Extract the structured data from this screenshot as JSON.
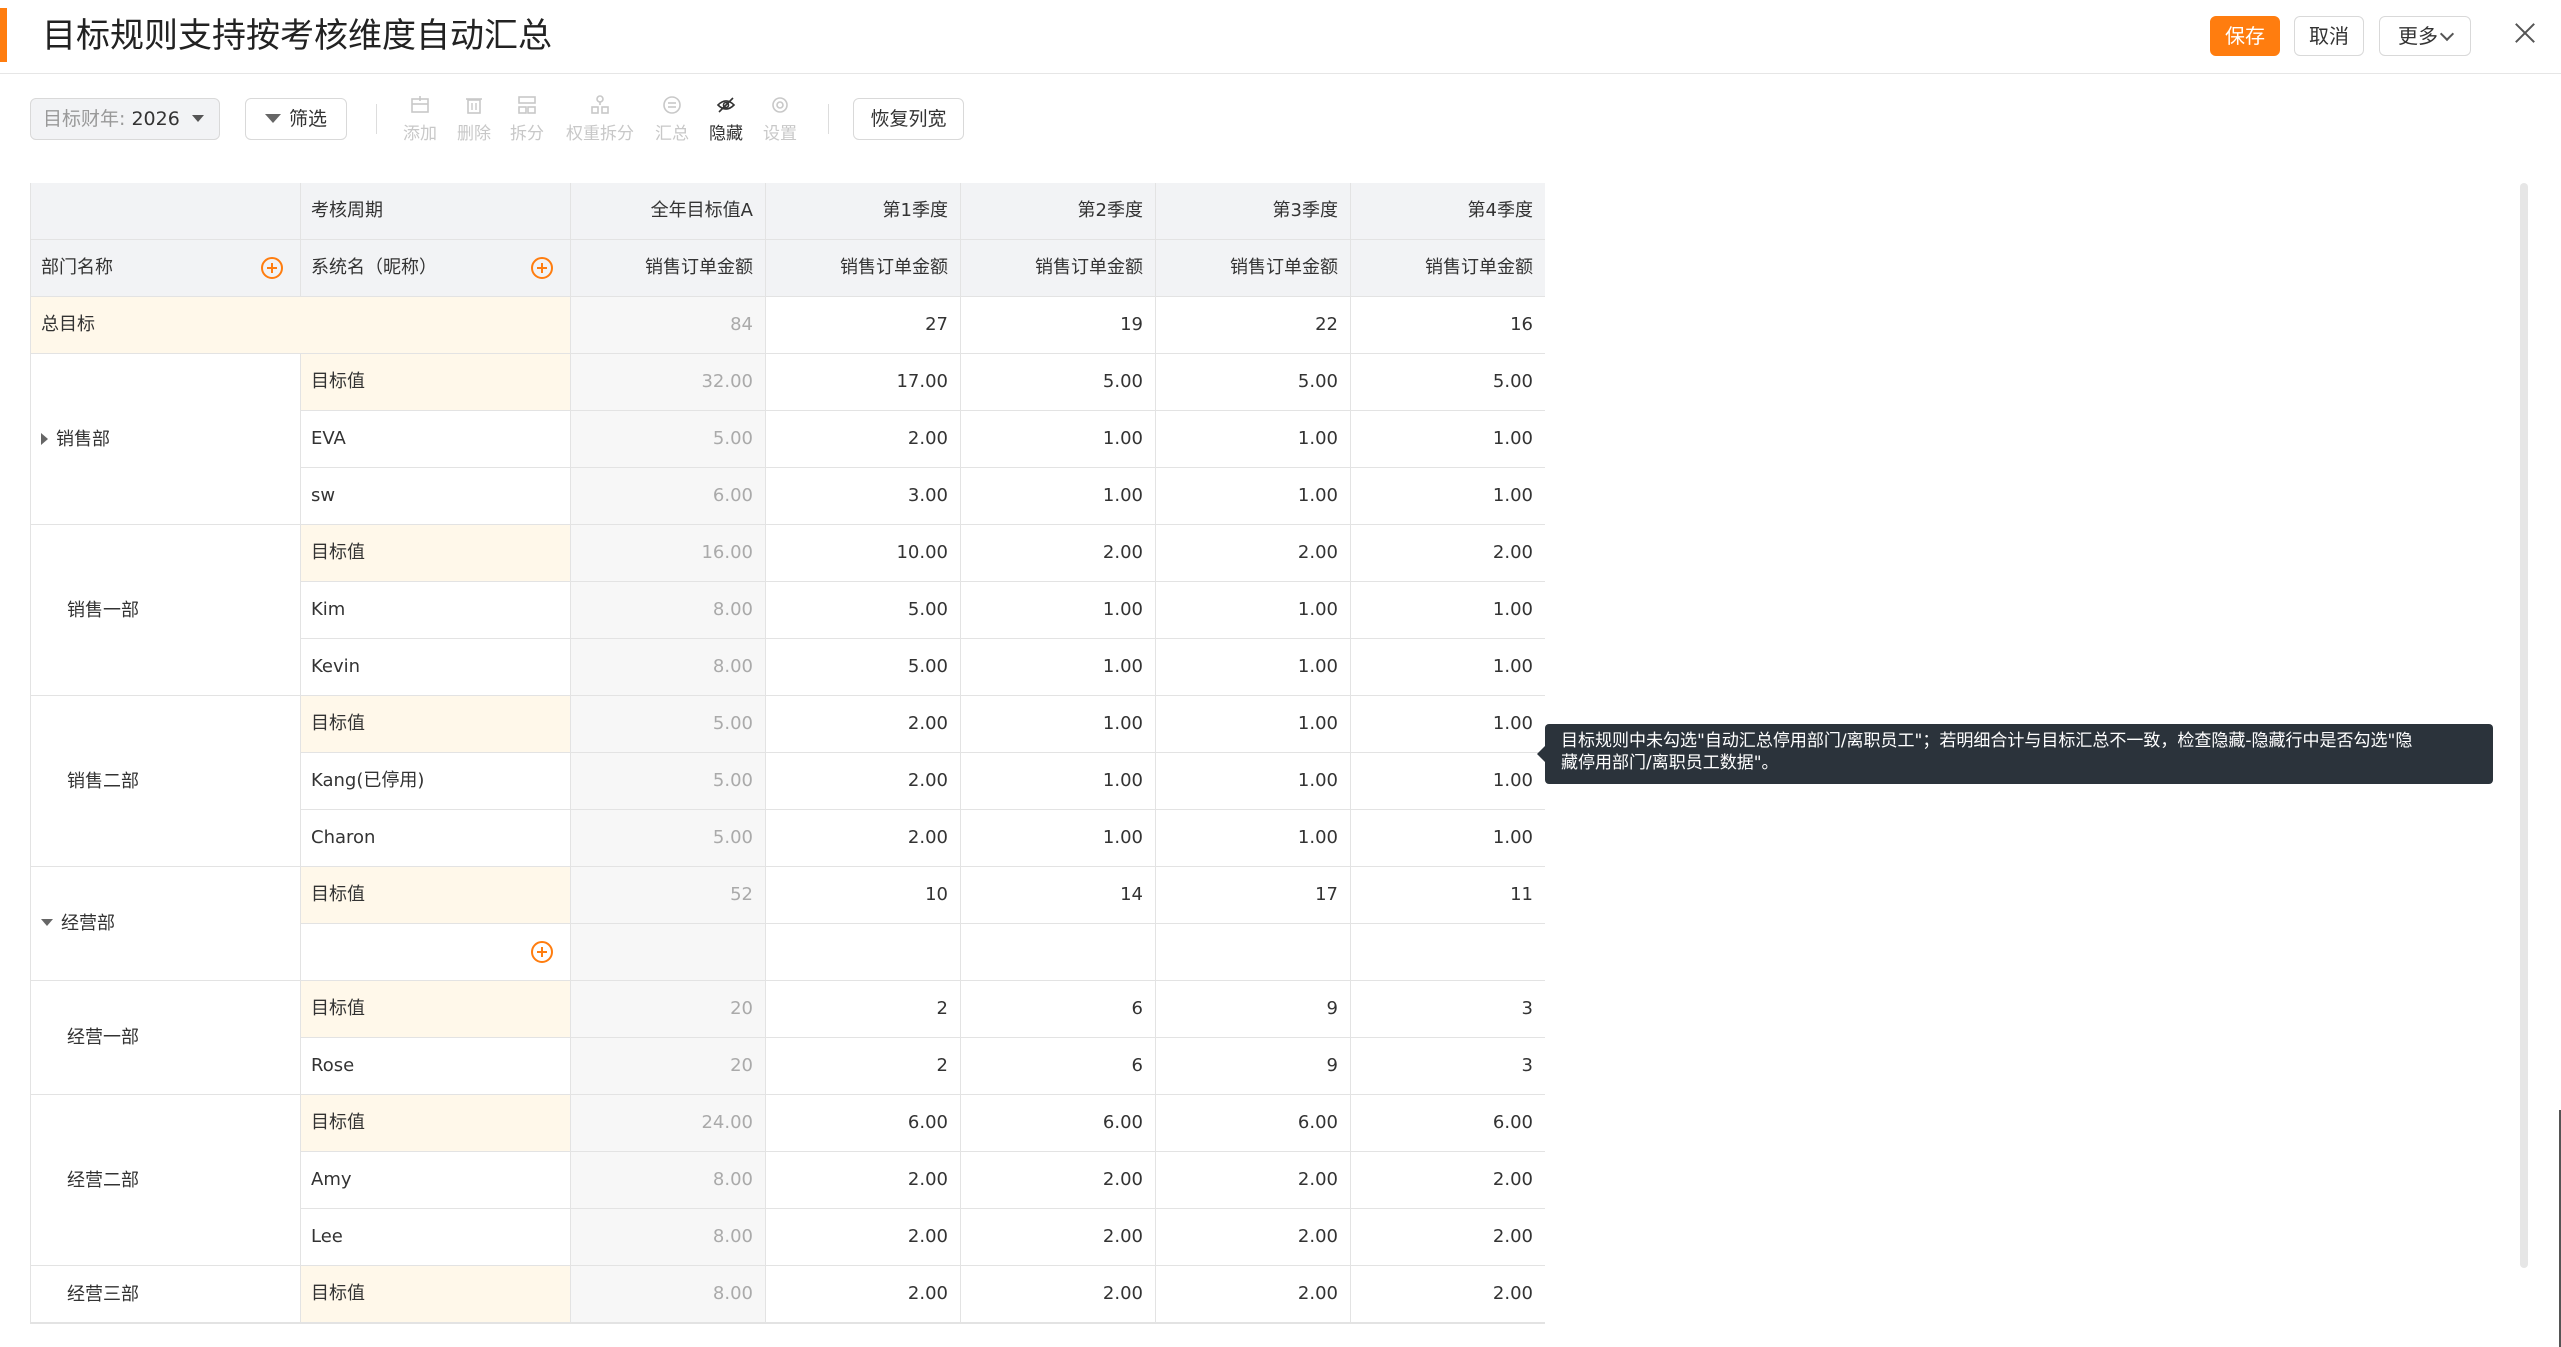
{
  "header": {
    "title": "目标规则支持按考核维度自动汇总",
    "save_label": "保存",
    "cancel_label": "取消",
    "more_label": "更多"
  },
  "toolbar": {
    "year_label": "目标财年:",
    "year_value": "2026",
    "filter_label": "筛选",
    "tools": {
      "add": "添加",
      "delete": "删除",
      "split": "拆分",
      "weight_split": "权重拆分",
      "summary": "汇总",
      "hide": "隐藏",
      "settings": "设置"
    },
    "restore_label": "恢复列宽"
  },
  "table": {
    "hdr_period": "考核周期",
    "hdr_dept": "部门名称",
    "hdr_name": "系统名（昵称）",
    "periods": [
      "全年目标值A",
      "第1季度",
      "第2季度",
      "第3季度",
      "第4季度"
    ],
    "metrics": [
      "销售订单金额",
      "销售订单金额",
      "销售订单金额",
      "销售订单金额",
      "销售订单金额"
    ],
    "total_label": "总目标",
    "total_values": [
      "84",
      "27",
      "19",
      "22",
      "16"
    ],
    "groups": [
      {
        "dept": "销售部",
        "expand": "collapsed",
        "rows": [
          {
            "label": "目标值",
            "vals": [
              "32.00",
              "17.00",
              "5.00",
              "5.00",
              "5.00"
            ]
          },
          {
            "label": "EVA",
            "vals": [
              "5.00",
              "2.00",
              "1.00",
              "1.00",
              "1.00"
            ]
          },
          {
            "label": "sw",
            "vals": [
              "6.00",
              "3.00",
              "1.00",
              "1.00",
              "1.00"
            ]
          }
        ]
      },
      {
        "dept": "销售一部",
        "expand": "none",
        "rows": [
          {
            "label": "目标值",
            "vals": [
              "16.00",
              "10.00",
              "2.00",
              "2.00",
              "2.00"
            ]
          },
          {
            "label": "Kim",
            "vals": [
              "8.00",
              "5.00",
              "1.00",
              "1.00",
              "1.00"
            ]
          },
          {
            "label": "Kevin",
            "vals": [
              "8.00",
              "5.00",
              "1.00",
              "1.00",
              "1.00"
            ]
          }
        ]
      },
      {
        "dept": "销售二部",
        "expand": "none",
        "rows": [
          {
            "label": "目标值",
            "vals": [
              "5.00",
              "2.00",
              "1.00",
              "1.00",
              "1.00"
            ]
          },
          {
            "label": "Kang(已停用)",
            "vals": [
              "5.00",
              "2.00",
              "1.00",
              "1.00",
              "1.00"
            ]
          },
          {
            "label": "Charon",
            "vals": [
              "5.00",
              "2.00",
              "1.00",
              "1.00",
              "1.00"
            ]
          }
        ]
      },
      {
        "dept": "经营部",
        "expand": "expanded",
        "rows": [
          {
            "label": "目标值",
            "vals": [
              "52",
              "10",
              "14",
              "17",
              "11"
            ]
          },
          {
            "label": "",
            "add": true,
            "vals": [
              "",
              "",
              "",
              "",
              ""
            ]
          }
        ]
      },
      {
        "dept": "经营一部",
        "expand": "none",
        "rows": [
          {
            "label": "目标值",
            "vals": [
              "20",
              "2",
              "6",
              "9",
              "3"
            ]
          },
          {
            "label": "Rose",
            "vals": [
              "20",
              "2",
              "6",
              "9",
              "3"
            ]
          }
        ]
      },
      {
        "dept": "经营二部",
        "expand": "none",
        "rows": [
          {
            "label": "目标值",
            "vals": [
              "24.00",
              "6.00",
              "6.00",
              "6.00",
              "6.00"
            ]
          },
          {
            "label": "Amy",
            "vals": [
              "8.00",
              "2.00",
              "2.00",
              "2.00",
              "2.00"
            ]
          },
          {
            "label": "Lee",
            "vals": [
              "8.00",
              "2.00",
              "2.00",
              "2.00",
              "2.00"
            ]
          }
        ]
      },
      {
        "dept": "经营三部",
        "expand": "none",
        "rows": [
          {
            "label": "目标值",
            "vals": [
              "8.00",
              "2.00",
              "2.00",
              "2.00",
              "2.00"
            ]
          }
        ]
      }
    ]
  },
  "tooltip": {
    "line1": "目标规则中未勾选\"自动汇总停用部门/离职员工\"；若明细合计与目标汇总不一致，检查隐藏-隐藏行中是否勾选\"隐",
    "line2": "藏停用部门/离职员工数据\"。"
  },
  "colors": {
    "accent": "#ff7d0f",
    "target_row_bg": "#fff8ea",
    "header_bg": "#f2f3f5",
    "tooltip_bg": "#2b333b"
  }
}
